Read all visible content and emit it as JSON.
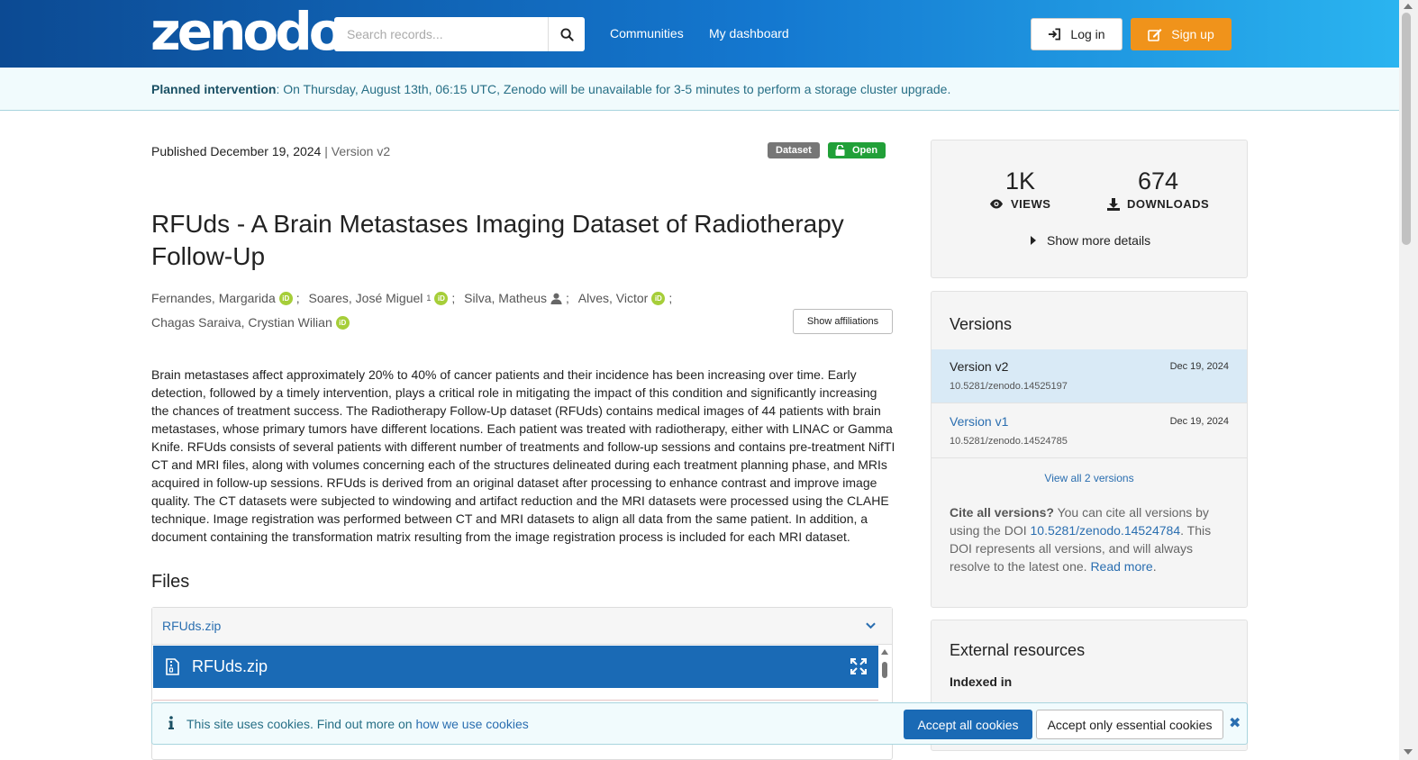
{
  "header": {
    "logo": "zenodo",
    "search_placeholder": "Search records...",
    "nav": [
      "Communities",
      "My dashboard"
    ],
    "login_label": "Log in",
    "signup_label": "Sign up"
  },
  "banner": {
    "title": "Planned intervention",
    "message": ": On Thursday, August 13th, 06:15 UTC, Zenodo will be unavailable for 3-5 minutes to perform a storage cluster upgrade."
  },
  "record": {
    "published": "Published December 19, 2024",
    "separator": " | ",
    "version": "Version v2",
    "resource_type": "Dataset",
    "access": "Open",
    "title": "RFUds - A Brain Metastases Imaging Dataset of Radiotherapy Follow-Up",
    "creators": [
      {
        "name": "Fernandes, Margarida",
        "sup": "",
        "icon": "orcid-icon",
        "sep": ";"
      },
      {
        "name": "Soares, José Miguel",
        "sup": "1",
        "icon": "orcid-icon",
        "sep": ";"
      },
      {
        "name": "Silva, Matheus",
        "sup": "",
        "icon": "person-icon",
        "sep": ";"
      },
      {
        "name": "Alves, Victor",
        "sup": "",
        "icon": "orcid-icon",
        "sep": ";"
      },
      {
        "name": "Chagas Saraiva, Crystian Wilian",
        "sup": "",
        "icon": "orcid-icon",
        "sep": ""
      }
    ],
    "show_affiliations": "Show affiliations",
    "description": "Brain metastases affect approximately 20% to 40% of cancer patients and their incidence has been increasing over time. Early detection, followed by a timely intervention, plays a critical role in mitigating the impact of this condition and significantly increasing the chances of treatment success. The Radiotherapy Follow-Up dataset (RFUds) contains medical images of 44 patients with brain metastases, whose primary tumors have different locations. Each patient was treated with radiotherapy, either with LINAC or Gamma Knife. RFUds consists of several patients with different number of treatments and follow-up sessions and contains pre-treatment NifTI CT and MRI files, along with volumes concerning each of the structures delineated during each treatment planning phase, and MRIs acquired in follow-up sessions. RFUds is derived from an original dataset after processing to enhance contrast and improve image quality. The CT datasets were subjected to windowing and artifact reduction and the MRI datasets were processed using the CLAHE technique. Image registration was performed between CT and MRI datasets to align all data from the same patient. In addition, a document containing the transformation matrix resulting from the image registration process is included for each MRI dataset."
  },
  "files": {
    "heading": "Files",
    "file_name": "RFUds.zip",
    "preview_name": "RFUds.zip"
  },
  "stats": {
    "views_value": "1K",
    "views_label": "VIEWS",
    "downloads_value": "674",
    "downloads_label": "DOWNLOADS",
    "more_details": "Show more details"
  },
  "versions": {
    "heading": "Versions",
    "items": [
      {
        "name": "Version v2",
        "date": "Dec 19, 2024",
        "doi": "10.5281/zenodo.14525197",
        "active": true
      },
      {
        "name": "Version v1",
        "date": "Dec 19, 2024",
        "doi": "10.5281/zenodo.14524785",
        "active": false
      }
    ],
    "view_all": "View all 2 versions",
    "cite_bold": "Cite all versions?",
    "cite_text1": " You can cite all versions by using the DOI ",
    "cite_doi": "10.5281/zenodo.14524784",
    "cite_text2": ". This DOI represents all versions, and will always resolve to the latest one. ",
    "read_more": "Read more",
    "cite_end": "."
  },
  "external": {
    "heading": "External resources",
    "indexed_in": "Indexed in"
  },
  "cookies": {
    "text": "This site uses cookies. Find out more on ",
    "link": "how we use cookies",
    "accept_all": "Accept all cookies",
    "accept_essential": "Accept only essential cookies"
  },
  "colors": {
    "header_gradient_start": "#0c4a93",
    "header_gradient_end": "#2ab4f0",
    "signup": "#f0931b",
    "open_badge": "#21a038",
    "link": "#2a6eb0",
    "preview_bar": "#1a6ab5"
  }
}
